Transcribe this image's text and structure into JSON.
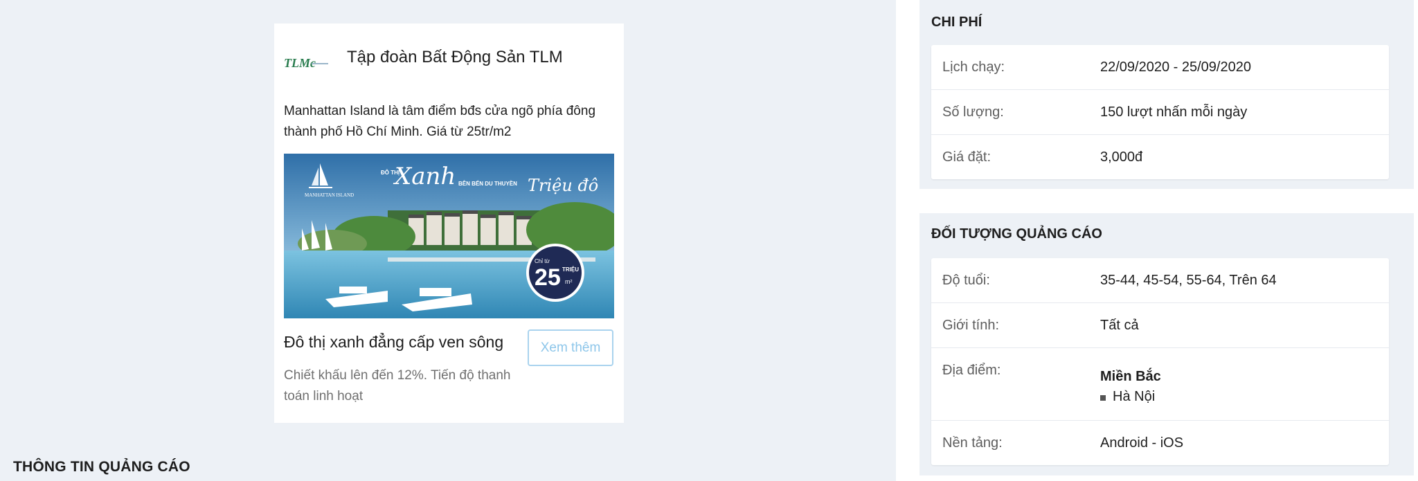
{
  "ad_preview": {
    "brand_name": "Tập đoàn Bất Động Sản TLM",
    "logo_text": "TLMc",
    "description": "Manhattan Island là tâm điểm bđs cửa ngõ phía đông thành phố Hồ Chí Minh. Giá từ 25tr/m2",
    "image": {
      "brand_mark": "MANHATTAN ISLAND",
      "tagline_small": "ĐÔ THỊ",
      "tagline_script": "Xanh",
      "tagline_mid": "BÊN BẾN DU THUYỀN",
      "tagline_script_2": "Triệu đô",
      "badge_prefix": "Chỉ từ",
      "badge_number": "25",
      "badge_unit": "TRIỆU",
      "badge_area": "m²"
    },
    "headline": "Đô thị xanh đẳng cấp ven sông",
    "subtext": "Chiết khấu lên đến 12%. Tiến độ thanh toán linh hoạt",
    "cta_label": "Xem thêm"
  },
  "ad_info_title": "THÔNG TIN QUẢNG CÁO",
  "cost": {
    "title": "CHI PHÍ",
    "rows": [
      {
        "label": "Lịch chạy:",
        "value": "22/09/2020 - 25/09/2020"
      },
      {
        "label": "Số lượng:",
        "value": "150 lượt nhấn mỗi ngày"
      },
      {
        "label": "Giá đặt:",
        "value": "3,000đ"
      }
    ]
  },
  "target": {
    "title": "ĐỐI TƯỢNG QUẢNG CÁO",
    "age_label": "Độ tuổi:",
    "age_value": "35-44, 45-54, 55-64, Trên 64",
    "gender_label": "Giới tính:",
    "gender_value": "Tất cả",
    "location_label": "Địa điểm:",
    "location_region": "Miền Bắc",
    "location_city": "Hà Nội",
    "platform_label": "Nền tảng:",
    "platform_value": "Android - iOS"
  },
  "colors": {
    "page_bg": "#edf1f6",
    "cta_border": "#a9d3ee",
    "cta_text": "#8dc6ea",
    "badge_bg": "#1f2a55"
  }
}
